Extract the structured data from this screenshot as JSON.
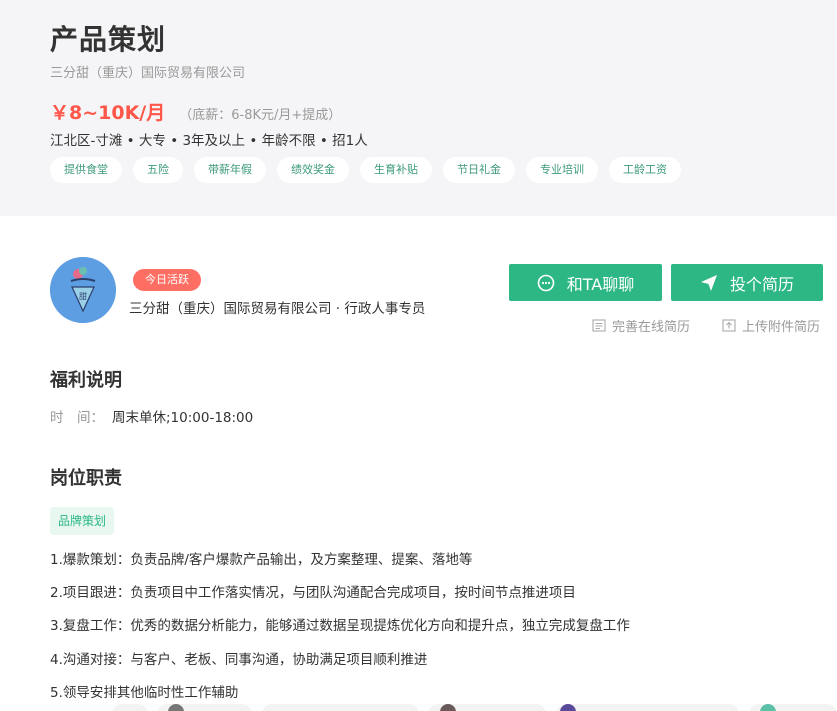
{
  "job": {
    "title": "产品策划",
    "company_line": "三分甜（重庆）国际贸易有限公司",
    "salary": "￥8~10K/月",
    "salary_note": "（底薪：6-8K元/月+提成）",
    "requirements": "江北区-寸滩 • 大专 • 3年及以上 • 年龄不限 • 招1人",
    "benefit_tags": [
      "提供食堂",
      "五险",
      "带薪年假",
      "绩效奖金",
      "生育补贴",
      "节日礼金",
      "专业培训",
      "工龄工资"
    ]
  },
  "recruiter": {
    "active_badge": "今日活跃",
    "info": "三分甜（重庆）国际贸易有限公司 · 行政人事专员"
  },
  "actions": {
    "chat_label": "和TA聊聊",
    "apply_label": "投个简历",
    "complete_resume_label": "完善在线简历",
    "upload_resume_label": "上传附件简历"
  },
  "welfare": {
    "title": "福利说明",
    "time_label": "时　间：",
    "time_value": "周末单休;10:00-18:00"
  },
  "duties": {
    "title": "岗位职责",
    "tag": "品牌策划",
    "items": [
      "1.爆款策划：负责品牌/客户爆款产品输出，及方案整理、提案、落地等",
      "2.项目跟进：负责项目中工作落实情况，与团队沟通配合完成项目，按时间节点推进项目",
      "3.复盘工作：优秀的数据分析能力，能够通过数据呈现提炼优化方向和提升点，独立完成复盘工作",
      "4.沟通对接：与客户、老板、同事沟通，协助满足项目顺利推进",
      "5.领导安排其他临时性工作辅助"
    ]
  },
  "colors": {
    "accent_green": "#2db785",
    "salary_red": "#fe574a",
    "badge_red": "#fe6e63",
    "header_bg": "#f5f5f7"
  }
}
